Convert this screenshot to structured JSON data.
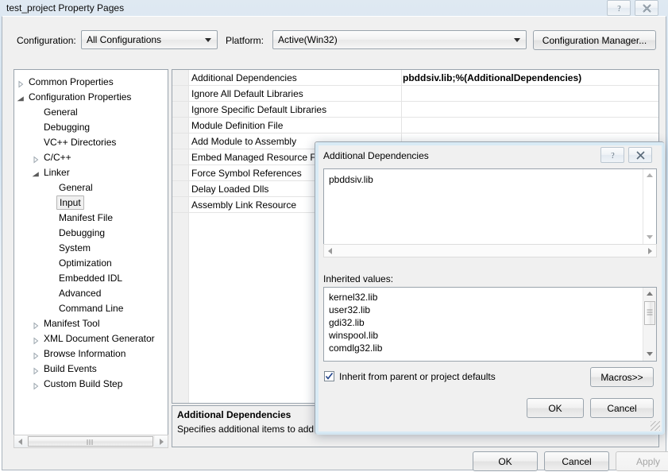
{
  "window": {
    "title": "test_project Property Pages",
    "help_button": "help-icon",
    "close_button": "close-icon"
  },
  "config_bar": {
    "configuration_label": "Configuration:",
    "configuration_value": "All Configurations",
    "platform_label": "Platform:",
    "platform_value": "Active(Win32)",
    "configuration_manager_button": "Configuration Manager..."
  },
  "tree": {
    "items": [
      {
        "label": "Common Properties",
        "indent": 0,
        "twisty": "collapsed",
        "selected": false
      },
      {
        "label": "Configuration Properties",
        "indent": 0,
        "twisty": "expanded",
        "selected": false
      },
      {
        "label": "General",
        "indent": 1,
        "twisty": "none",
        "selected": false
      },
      {
        "label": "Debugging",
        "indent": 1,
        "twisty": "none",
        "selected": false
      },
      {
        "label": "VC++ Directories",
        "indent": 1,
        "twisty": "none",
        "selected": false
      },
      {
        "label": "C/C++",
        "indent": 1,
        "twisty": "collapsed",
        "selected": false
      },
      {
        "label": "Linker",
        "indent": 1,
        "twisty": "expanded",
        "selected": false
      },
      {
        "label": "General",
        "indent": 2,
        "twisty": "none",
        "selected": false
      },
      {
        "label": "Input",
        "indent": 2,
        "twisty": "none",
        "selected": true
      },
      {
        "label": "Manifest File",
        "indent": 2,
        "twisty": "none",
        "selected": false
      },
      {
        "label": "Debugging",
        "indent": 2,
        "twisty": "none",
        "selected": false
      },
      {
        "label": "System",
        "indent": 2,
        "twisty": "none",
        "selected": false
      },
      {
        "label": "Optimization",
        "indent": 2,
        "twisty": "none",
        "selected": false
      },
      {
        "label": "Embedded IDL",
        "indent": 2,
        "twisty": "none",
        "selected": false
      },
      {
        "label": "Advanced",
        "indent": 2,
        "twisty": "none",
        "selected": false
      },
      {
        "label": "Command Line",
        "indent": 2,
        "twisty": "none",
        "selected": false
      },
      {
        "label": "Manifest Tool",
        "indent": 1,
        "twisty": "collapsed",
        "selected": false
      },
      {
        "label": "XML Document Generator",
        "indent": 1,
        "twisty": "collapsed",
        "selected": false
      },
      {
        "label": "Browse Information",
        "indent": 1,
        "twisty": "collapsed",
        "selected": false
      },
      {
        "label": "Build Events",
        "indent": 1,
        "twisty": "collapsed",
        "selected": false
      },
      {
        "label": "Custom Build Step",
        "indent": 1,
        "twisty": "collapsed",
        "selected": false
      }
    ]
  },
  "property_grid": {
    "rows": [
      {
        "name": "Additional Dependencies",
        "value": "pbddsiv.lib;%(AdditionalDependencies)"
      },
      {
        "name": "Ignore All Default Libraries",
        "value": ""
      },
      {
        "name": "Ignore Specific Default Libraries",
        "value": ""
      },
      {
        "name": "Module Definition File",
        "value": ""
      },
      {
        "name": "Add Module to Assembly",
        "value": ""
      },
      {
        "name": "Embed Managed Resource File",
        "value": ""
      },
      {
        "name": "Force Symbol References",
        "value": ""
      },
      {
        "name": "Delay Loaded Dlls",
        "value": ""
      },
      {
        "name": "Assembly Link Resource",
        "value": ""
      }
    ]
  },
  "description": {
    "title": "Additional Dependencies",
    "text": "Specifies additional items to add t"
  },
  "footer": {
    "ok": "OK",
    "cancel": "Cancel",
    "apply": "Apply"
  },
  "modal": {
    "title": "Additional Dependencies",
    "help_button": "help-icon",
    "close_button": "close-icon",
    "edit_value": "pbddsiv.lib",
    "inherited_label": "Inherited values:",
    "inherited_values": [
      "kernel32.lib",
      "user32.lib",
      "gdi32.lib",
      "winspool.lib",
      "comdlg32.lib"
    ],
    "inherit_checkbox_label": "Inherit from parent or project defaults",
    "inherit_checkbox_checked": true,
    "macros_button": "Macros>>",
    "ok": "OK",
    "cancel": "Cancel"
  },
  "colors": {
    "dialog_face": "#f0f0f0",
    "field_bg": "#ffffff",
    "border": "#9aa4ad",
    "selection": "#f0f0f0",
    "disabled_text": "#a6a6a6"
  }
}
